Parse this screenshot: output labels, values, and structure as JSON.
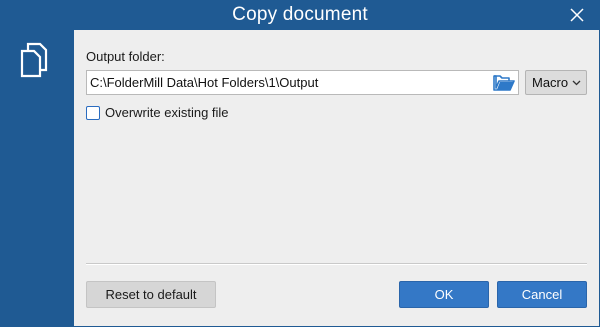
{
  "window": {
    "title": "Copy document",
    "icons": {
      "close": "close-icon",
      "sidebar": "copy-document-icon",
      "browse": "open-folder-icon",
      "dropdown": "chevron-down-icon"
    }
  },
  "form": {
    "output_folder_label": "Output folder:",
    "output_folder_value": "C:\\FolderMill Data\\Hot Folders\\1\\Output",
    "macro_label": "Macro",
    "overwrite_label": "Overwrite existing file",
    "overwrite_checked": false
  },
  "buttons": {
    "reset": "Reset to default",
    "ok": "OK",
    "cancel": "Cancel"
  },
  "colors": {
    "titlebar": "#1f5a93",
    "content_bg": "#eeeeee",
    "primary_button": "#3478c6",
    "folder_icon": "#2e79c8"
  }
}
